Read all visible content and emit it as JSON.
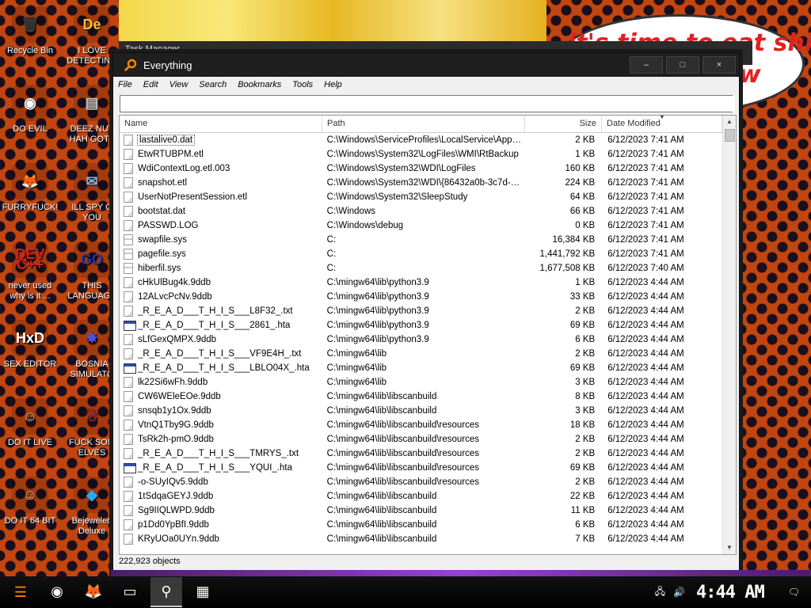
{
  "desktop": {
    "icons": [
      {
        "label": "Recycle Bin",
        "glyph": "🗑",
        "color": "#3b3b3b"
      },
      {
        "label": "I LOVE DETECTING",
        "glyph": "De",
        "color": "#f2c23a"
      },
      {
        "label": "DO EVIL",
        "glyph": "◉",
        "color": "#ffffff"
      },
      {
        "label": "DEEZ NUT HAH GOTT",
        "glyph": "▤",
        "color": "#c9c9c9"
      },
      {
        "label": "FURRYFUCK!",
        "glyph": "🦊",
        "color": "#ff7a1a"
      },
      {
        "label": "ILL SPY O YOU",
        "glyph": "✉",
        "color": "#8fb0e0"
      },
      {
        "label": "never used why is it ...",
        "glyph": "DEV C++",
        "color": "#d32020"
      },
      {
        "label": "THIS LANGUAGE",
        "glyph": "GO",
        "color": "#2236a8"
      },
      {
        "label": "SEX EDITOR",
        "glyph": "HxD",
        "color": "#ffffff"
      },
      {
        "label": "BOSNIA SIMULATO",
        "glyph": "✸",
        "color": "#5050d8"
      },
      {
        "label": "DO IT LIVE",
        "glyph": "☺",
        "color": "#e8c090"
      },
      {
        "label": "FUCK SOM ELVES",
        "glyph": "☃",
        "color": "#c03030"
      },
      {
        "label": "DO IT 64 BIT",
        "glyph": "☺",
        "color": "#e8c090"
      },
      {
        "label": "Bejeweled Deluxe",
        "glyph": "◆",
        "color": "#2aa8f0"
      }
    ],
    "banner_line1": "it's time to eat shit",
    "banner_line2": "w",
    "behind_window_title": "Task Manager"
  },
  "window": {
    "title": "Everything",
    "controls": {
      "minimize": "–",
      "maximize": "□",
      "close": "×"
    },
    "menu": [
      "File",
      "Edit",
      "View",
      "Search",
      "Bookmarks",
      "Tools",
      "Help"
    ],
    "search": {
      "value": "",
      "placeholder": ""
    },
    "columns": {
      "name": "Name",
      "path": "Path",
      "size": "Size",
      "date": "Date Modified"
    },
    "rows": [
      {
        "name": "lastalive0.dat",
        "path": "C:\\Windows\\ServiceProfiles\\LocalService\\AppDat...",
        "size": "2 KB",
        "date": "6/12/2023 7:41 AM",
        "icon": "file"
      },
      {
        "name": "EtwRTUBPM.etl",
        "path": "C:\\Windows\\System32\\LogFiles\\WMI\\RtBackup",
        "size": "1 KB",
        "date": "6/12/2023 7:41 AM",
        "icon": "file"
      },
      {
        "name": "WdiContextLog.etl.003",
        "path": "C:\\Windows\\System32\\WDI\\LogFiles",
        "size": "160 KB",
        "date": "6/12/2023 7:41 AM",
        "icon": "file"
      },
      {
        "name": "snapshot.etl",
        "path": "C:\\Windows\\System32\\WDI\\{86432a0b-3c7d-4d...",
        "size": "224 KB",
        "date": "6/12/2023 7:41 AM",
        "icon": "file"
      },
      {
        "name": "UserNotPresentSession.etl",
        "path": "C:\\Windows\\System32\\SleepStudy",
        "size": "64 KB",
        "date": "6/12/2023 7:41 AM",
        "icon": "file"
      },
      {
        "name": "bootstat.dat",
        "path": "C:\\Windows",
        "size": "66 KB",
        "date": "6/12/2023 7:41 AM",
        "icon": "file"
      },
      {
        "name": "PASSWD.LOG",
        "path": "C:\\Windows\\debug",
        "size": "0 KB",
        "date": "6/12/2023 7:41 AM",
        "icon": "file"
      },
      {
        "name": "swapfile.sys",
        "path": "C:",
        "size": "16,384 KB",
        "date": "6/12/2023 7:41 AM",
        "icon": "sys"
      },
      {
        "name": "pagefile.sys",
        "path": "C:",
        "size": "1,441,792 KB",
        "date": "6/12/2023 7:41 AM",
        "icon": "sys"
      },
      {
        "name": "hiberfil.sys",
        "path": "C:",
        "size": "1,677,508 KB",
        "date": "6/12/2023 7:40 AM",
        "icon": "sys"
      },
      {
        "name": "cHkUlBug4k.9ddb",
        "path": "C:\\mingw64\\lib\\python3.9",
        "size": "1 KB",
        "date": "6/12/2023 4:44 AM",
        "icon": "file"
      },
      {
        "name": "12ALvcPcNv.9ddb",
        "path": "C:\\mingw64\\lib\\python3.9",
        "size": "33 KB",
        "date": "6/12/2023 4:44 AM",
        "icon": "file"
      },
      {
        "name": "_R_E_A_D___T_H_I_S___L8F32_.txt",
        "path": "C:\\mingw64\\lib\\python3.9",
        "size": "2 KB",
        "date": "6/12/2023 4:44 AM",
        "icon": "file"
      },
      {
        "name": "_R_E_A_D___T_H_I_S___2861_.hta",
        "path": "C:\\mingw64\\lib\\python3.9",
        "size": "69 KB",
        "date": "6/12/2023 4:44 AM",
        "icon": "hta"
      },
      {
        "name": "sLfGexQMPX.9ddb",
        "path": "C:\\mingw64\\lib\\python3.9",
        "size": "6 KB",
        "date": "6/12/2023 4:44 AM",
        "icon": "file"
      },
      {
        "name": "_R_E_A_D___T_H_I_S___VF9E4H_.txt",
        "path": "C:\\mingw64\\lib",
        "size": "2 KB",
        "date": "6/12/2023 4:44 AM",
        "icon": "file"
      },
      {
        "name": "_R_E_A_D___T_H_I_S___LBLO04X_.hta",
        "path": "C:\\mingw64\\lib",
        "size": "69 KB",
        "date": "6/12/2023 4:44 AM",
        "icon": "hta"
      },
      {
        "name": "lk22Si6wFh.9ddb",
        "path": "C:\\mingw64\\lib",
        "size": "3 KB",
        "date": "6/12/2023 4:44 AM",
        "icon": "file"
      },
      {
        "name": "CW6WEleEOe.9ddb",
        "path": "C:\\mingw64\\lib\\libscanbuild",
        "size": "8 KB",
        "date": "6/12/2023 4:44 AM",
        "icon": "file"
      },
      {
        "name": "snsqb1y1Ox.9ddb",
        "path": "C:\\mingw64\\lib\\libscanbuild",
        "size": "3 KB",
        "date": "6/12/2023 4:44 AM",
        "icon": "file"
      },
      {
        "name": "VtnQ1Tby9G.9ddb",
        "path": "C:\\mingw64\\lib\\libscanbuild\\resources",
        "size": "18 KB",
        "date": "6/12/2023 4:44 AM",
        "icon": "file"
      },
      {
        "name": "TsRk2h-pmO.9ddb",
        "path": "C:\\mingw64\\lib\\libscanbuild\\resources",
        "size": "2 KB",
        "date": "6/12/2023 4:44 AM",
        "icon": "file"
      },
      {
        "name": "_R_E_A_D___T_H_I_S___TMRYS_.txt",
        "path": "C:\\mingw64\\lib\\libscanbuild\\resources",
        "size": "2 KB",
        "date": "6/12/2023 4:44 AM",
        "icon": "file"
      },
      {
        "name": "_R_E_A_D___T_H_I_S___YQUI_.hta",
        "path": "C:\\mingw64\\lib\\libscanbuild\\resources",
        "size": "69 KB",
        "date": "6/12/2023 4:44 AM",
        "icon": "hta"
      },
      {
        "name": "-o-SUyIQv5.9ddb",
        "path": "C:\\mingw64\\lib\\libscanbuild\\resources",
        "size": "2 KB",
        "date": "6/12/2023 4:44 AM",
        "icon": "file"
      },
      {
        "name": "1tSdqaGEYJ.9ddb",
        "path": "C:\\mingw64\\lib\\libscanbuild",
        "size": "22 KB",
        "date": "6/12/2023 4:44 AM",
        "icon": "file"
      },
      {
        "name": "Sg9IIQLWPD.9ddb",
        "path": "C:\\mingw64\\lib\\libscanbuild",
        "size": "11 KB",
        "date": "6/12/2023 4:44 AM",
        "icon": "file"
      },
      {
        "name": "p1Dd0YpBfI.9ddb",
        "path": "C:\\mingw64\\lib\\libscanbuild",
        "size": "6 KB",
        "date": "6/12/2023 4:44 AM",
        "icon": "file"
      },
      {
        "name": "KRyUOa0UYn.9ddb",
        "path": "C:\\mingw64\\lib\\libscanbuild",
        "size": "7 KB",
        "date": "6/12/2023 4:44 AM",
        "icon": "file"
      }
    ],
    "status": "222,923 objects"
  },
  "taskbar": {
    "start_icon": "start-icon",
    "pinned": [
      {
        "name": "chrome-icon",
        "glyph": "◉"
      },
      {
        "name": "firefox-icon",
        "glyph": "🦊"
      },
      {
        "name": "file-explorer-icon",
        "glyph": "▭"
      },
      {
        "name": "everything-search-icon",
        "glyph": "⚲",
        "active": true
      },
      {
        "name": "task-manager-icon",
        "glyph": "▦"
      }
    ],
    "clock": "4:44 AM"
  }
}
